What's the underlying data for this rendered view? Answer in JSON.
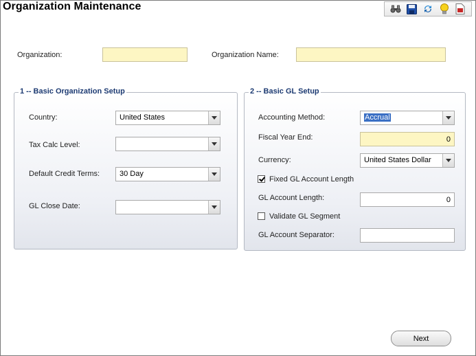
{
  "window": {
    "title": "Organization Maintenance"
  },
  "toolbar": {
    "icons": [
      "binoculars-icon",
      "save-icon",
      "refresh-icon",
      "lightbulb-icon",
      "report-icon"
    ]
  },
  "header": {
    "organization_label": "Organization:",
    "organization_value": "",
    "organization_name_label": "Organization Name:",
    "organization_name_value": ""
  },
  "basic_org_setup": {
    "title": "1 -- Basic Organization Setup",
    "country_label": "Country:",
    "country_value": "United States",
    "tax_calc_label": "Tax Calc Level:",
    "tax_calc_value": "",
    "credit_terms_label": "Default Credit Terms:",
    "credit_terms_value": "30 Day",
    "gl_close_label": "GL Close Date:",
    "gl_close_value": ""
  },
  "basic_gl_setup": {
    "title": "2 -- Basic GL Setup",
    "accounting_method_label": "Accounting Method:",
    "accounting_method_value": "Accrual",
    "fiscal_year_label": "Fiscal Year End:",
    "fiscal_year_value": "0",
    "currency_label": "Currency:",
    "currency_value": "United States Dollar",
    "fixed_length_label": "Fixed GL Account Length",
    "fixed_length_checked": true,
    "gl_length_label": "GL Account Length:",
    "gl_length_value": "0",
    "validate_segment_label": "Validate GL Segment",
    "validate_segment_checked": false,
    "separator_label": "GL Account Separator:",
    "separator_value": ""
  },
  "footer": {
    "next_label": "Next"
  }
}
